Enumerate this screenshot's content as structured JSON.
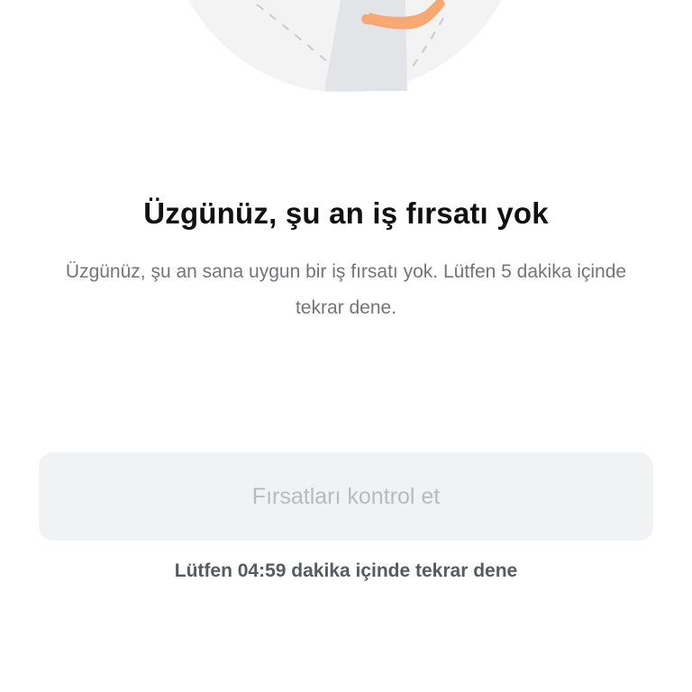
{
  "illustration": {
    "icon": "person-illustration",
    "colors": {
      "circle": "#f3f3f4",
      "shirt": "#e8e8ea",
      "skin": "#f7a873",
      "dashes": "#c9cbd0"
    }
  },
  "empty_state": {
    "title": "Üzgünüz, şu an iş fırsatı yok",
    "message": "Üzgünüz, şu an sana uygun bir iş fırsatı yok. Lütfen 5 dakika içinde tekrar dene."
  },
  "actions": {
    "check_label": "Fırsatları kontrol et",
    "disabled": true,
    "retry_note": "Lütfen 04:59 dakika içinde tekrar dene"
  },
  "colors": {
    "button_bg": "#f1f2f4",
    "button_text": "#b8bac0",
    "title": "#111111",
    "body_text": "#74757a",
    "note_text": "#555a63"
  }
}
